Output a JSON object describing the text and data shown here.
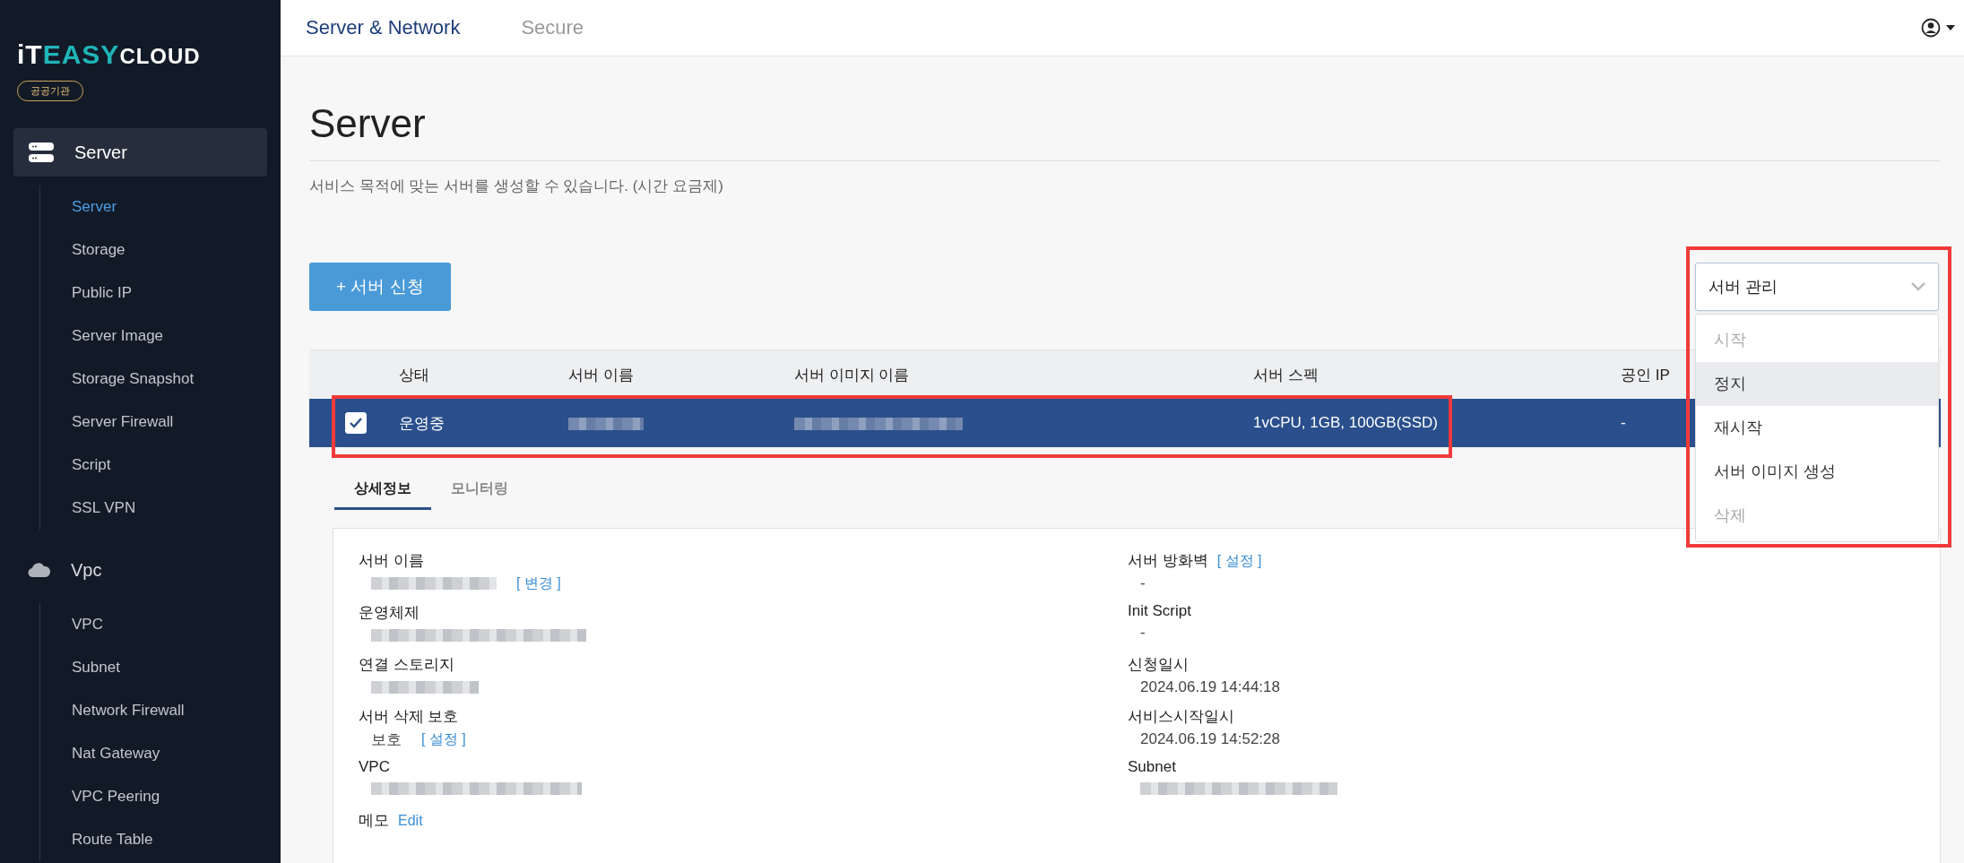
{
  "brand": {
    "logo_prefix": "iT",
    "logo_middle": "EASY",
    "logo_suffix": "CLOUD",
    "badge": "공공기관"
  },
  "sidebar": {
    "groups": [
      {
        "label": "Server",
        "kind": "server",
        "selected": true,
        "children": [
          {
            "label": "Server",
            "selected": true
          },
          {
            "label": "Storage",
            "selected": false
          },
          {
            "label": "Public IP",
            "selected": false
          },
          {
            "label": "Server Image",
            "selected": false
          },
          {
            "label": "Storage Snapshot",
            "selected": false
          },
          {
            "label": "Server Firewall",
            "selected": false
          },
          {
            "label": "Script",
            "selected": false
          },
          {
            "label": "SSL VPN",
            "selected": false
          }
        ]
      },
      {
        "label": "Vpc",
        "kind": "cloud",
        "selected": false,
        "children": [
          {
            "label": "VPC",
            "selected": false
          },
          {
            "label": "Subnet",
            "selected": false
          },
          {
            "label": "Network Firewall",
            "selected": false
          },
          {
            "label": "Nat Gateway",
            "selected": false
          },
          {
            "label": "VPC Peering",
            "selected": false
          },
          {
            "label": "Route Table",
            "selected": false
          }
        ]
      }
    ]
  },
  "topnav": [
    {
      "label": "Server & Network",
      "selected": true
    },
    {
      "label": "Secure",
      "selected": false
    }
  ],
  "page": {
    "title": "Server",
    "description": "서비스 목적에 맞는 서버를 생성할 수 있습니다. (시간 요금제)"
  },
  "create_button": "+ 서버 신청",
  "manage_dropdown": {
    "value": "서버 관리",
    "expanded": true,
    "annotated": true,
    "options": [
      {
        "label": "시작",
        "disabled": true,
        "highlighted": false
      },
      {
        "label": "정지",
        "disabled": false,
        "highlighted": true
      },
      {
        "label": "재시작",
        "disabled": false,
        "highlighted": false
      },
      {
        "label": "서버 이미지 생성",
        "disabled": false,
        "highlighted": false
      },
      {
        "label": "삭제",
        "disabled": true,
        "highlighted": false
      }
    ]
  },
  "table": {
    "columns": [
      "상태",
      "서버 이름",
      "서버 이미지 이름",
      "서버 스펙",
      "공인 IP"
    ],
    "rows": [
      {
        "checked": true,
        "selected": true,
        "annotated": true,
        "status": "운영중",
        "spec": "1vCPU, 1GB, 100GB(SSD)",
        "public_ip": "-"
      }
    ]
  },
  "detail_tabs": [
    {
      "label": "상세정보",
      "selected": true
    },
    {
      "label": "모니터링",
      "selected": false
    }
  ],
  "details": {
    "left": [
      {
        "kind": "stacked",
        "label": "서버 이름",
        "redacted": true,
        "action": "[ 변경 ]"
      },
      {
        "kind": "stacked",
        "label": "운영체제",
        "redacted": true
      },
      {
        "kind": "stacked",
        "label": "연결 스토리지",
        "redacted": true
      },
      {
        "kind": "stacked",
        "label": "서버 삭제 보호",
        "value": "보호",
        "action": "[ 설정 ]"
      },
      {
        "kind": "stacked",
        "label": "VPC",
        "redacted": true
      },
      {
        "kind": "inline",
        "label": "메모",
        "action": "Edit"
      }
    ],
    "right": [
      {
        "kind": "stacked",
        "label": "서버 방화벽",
        "label_action": "[ 설정 ]",
        "value": "-"
      },
      {
        "kind": "stacked",
        "label": "Init Script",
        "value": "-"
      },
      {
        "kind": "stacked",
        "label": "신청일시",
        "value": "2024.06.19 14:44:18"
      },
      {
        "kind": "stacked",
        "label": "서비스시작일시",
        "value": "2024.06.19 14:52:28"
      },
      {
        "kind": "stacked",
        "label": "Subnet",
        "redacted": true
      }
    ]
  }
}
